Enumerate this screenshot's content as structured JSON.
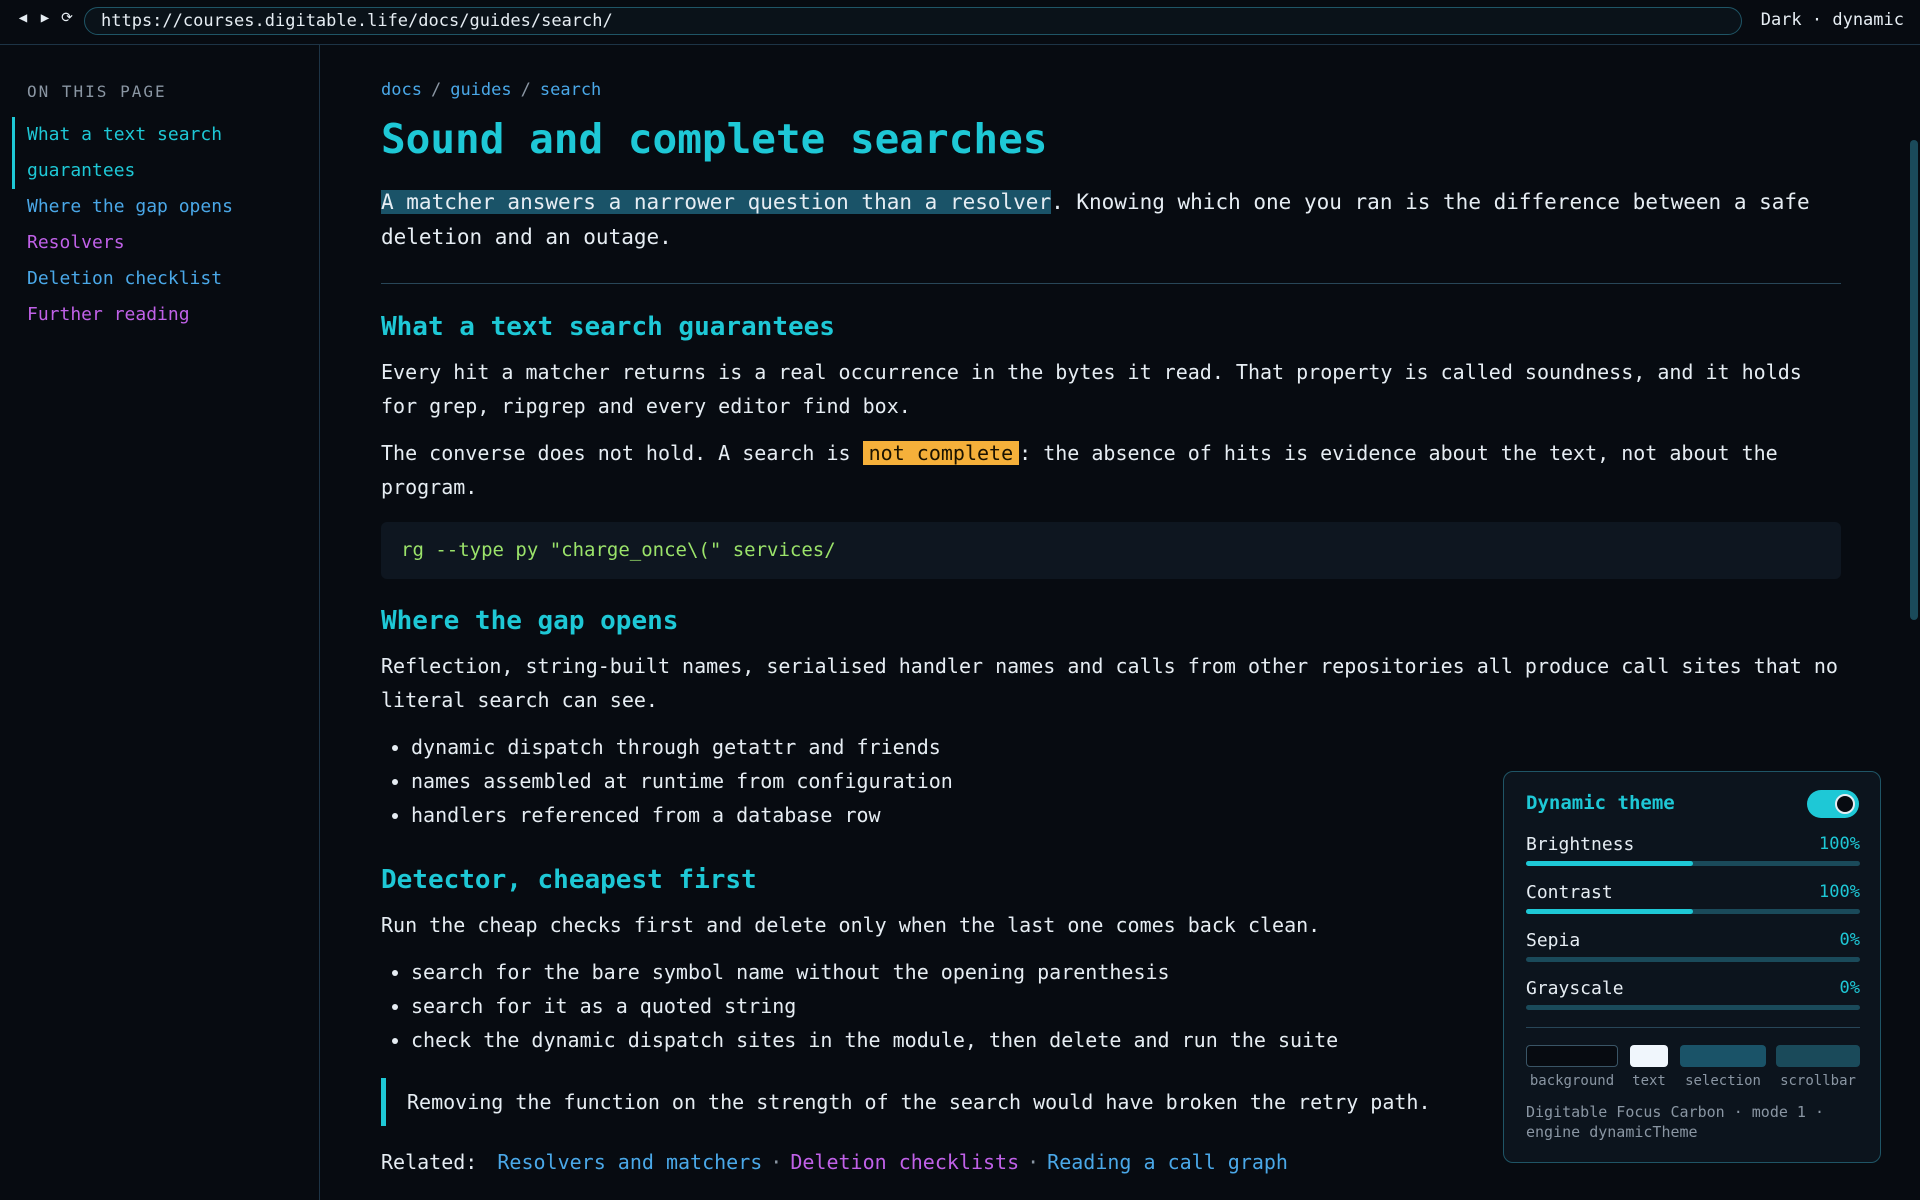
{
  "browser": {
    "back_icon": "◀",
    "forward_icon": "▶",
    "reload_icon": "⟳",
    "url": "https://courses.digitable.life/docs/guides/search/",
    "theme_label": "Dark · dynamic"
  },
  "sidebar": {
    "heading": "ON THIS PAGE",
    "items": [
      {
        "label": "What a text search guarantees",
        "active": true
      },
      {
        "label": "Where the gap opens"
      },
      {
        "label": "Resolvers"
      },
      {
        "label": "Deletion checklist"
      },
      {
        "label": "Further reading"
      }
    ]
  },
  "breadcrumb": {
    "items": [
      "docs",
      "guides",
      "search"
    ],
    "separator": "/"
  },
  "page": {
    "title": "Sound and complete searches",
    "lead_highlight": "A matcher answers a narrower question than a resolver",
    "lead_rest": ". Knowing which one you ran is the difference between a safe deletion and an outage.",
    "sections": {
      "s1": {
        "heading": "What a text search guarantees",
        "p1": "Every hit a matcher returns is a real occurrence in the bytes it read. That property is called soundness, and it holds for grep, ripgrep and every editor find box.",
        "p2_before": "The converse does not hold. A search is ",
        "p2_mark": "not complete",
        "p2_after": ": the absence of hits is evidence about the text, not about the program.",
        "code": "rg --type py \"charge_once\\(\" services/"
      },
      "s2": {
        "heading": "Where the gap opens",
        "p1": "Reflection, string-built names, serialised handler names and calls from other repositories all produce call sites that no literal search can see.",
        "bullets": [
          "dynamic dispatch through getattr and friends",
          "names assembled at runtime from configuration",
          "handlers referenced from a database row"
        ]
      },
      "s3": {
        "heading": "Detector, cheapest first",
        "p1": "Run the cheap checks first and delete only when the last one comes back clean.",
        "bullets": [
          "search for the bare symbol name without the opening parenthesis",
          "search for it as a quoted string",
          "check the dynamic dispatch sites in the module, then delete and run the suite"
        ]
      }
    },
    "quote": "Removing the function on the strength of the search would have broken the retry path.",
    "related_label": "Related:",
    "related_sep": "·",
    "related_links": [
      {
        "label": "Resolvers and matchers",
        "color": "#4aa8e8"
      },
      {
        "label": "Deletion checklists",
        "color": "#c061e8"
      },
      {
        "label": "Reading a call graph",
        "color": "#4aa8e8"
      }
    ]
  },
  "theme_panel": {
    "title": "Dynamic theme",
    "enabled": true,
    "sliders": [
      {
        "label": "Brightness",
        "value": "100%",
        "fraction": 0.5
      },
      {
        "label": "Contrast",
        "value": "100%",
        "fraction": 0.5
      },
      {
        "label": "Sepia",
        "value": "0%",
        "fraction": 0
      },
      {
        "label": "Grayscale",
        "value": "0%",
        "fraction": 0
      }
    ],
    "swatches": [
      {
        "label": "background",
        "color": "#070b11"
      },
      {
        "label": "text",
        "color": "#f0f6fc"
      },
      {
        "label": "selection",
        "color": "#1a5368"
      },
      {
        "label": "scrollbar",
        "color": "#1a4a5a"
      }
    ],
    "footer": "Digitable Focus Carbon · mode 1 · engine dynamicTheme"
  },
  "colors": {
    "accent": "#1ec8d6",
    "link_blue": "#4aa8e8",
    "link_purple": "#c061e8",
    "mark": "#f5b03a",
    "code": "#9be36a"
  }
}
